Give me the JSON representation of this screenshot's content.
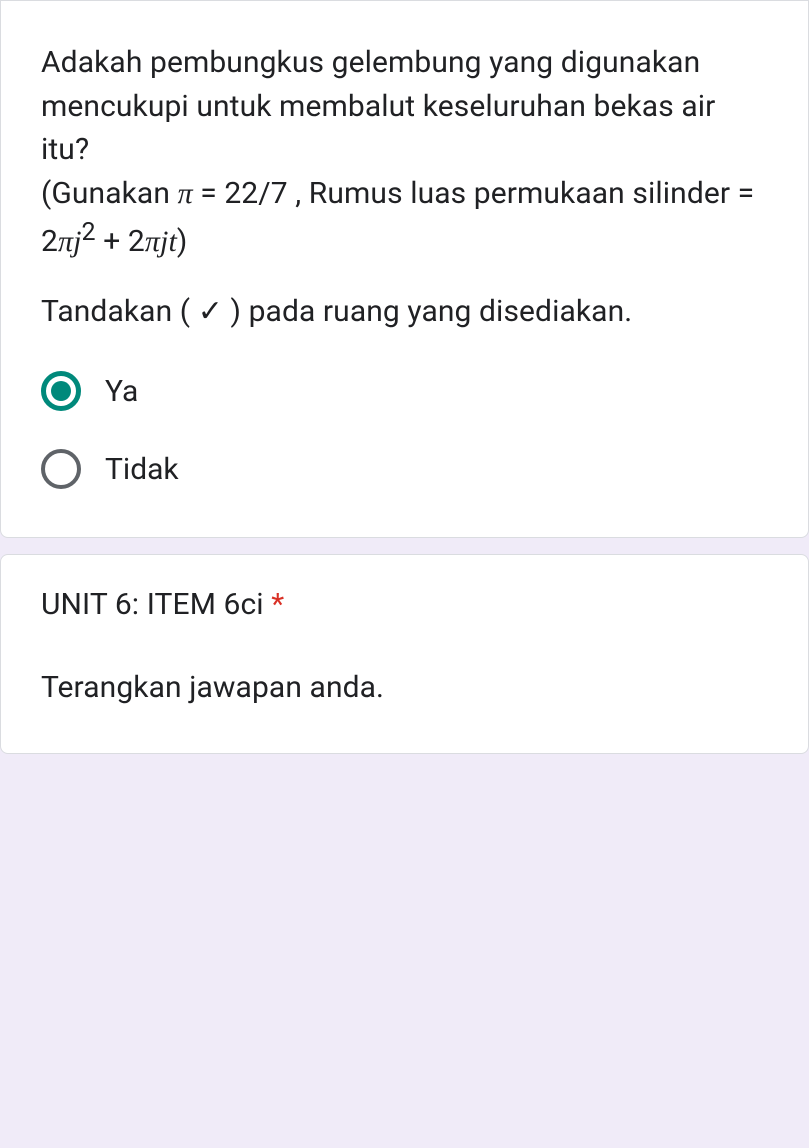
{
  "question1": {
    "line1": "Adakah pembungkus gelembung yang digunakan mencukupi untuk membalut keseluruhan bekas air itu?",
    "pi_prefix": "(Gunakan ",
    "pi_symbol": "π",
    "pi_value": " = 22/7 , Rumus luas permukaan silinder = 2",
    "pi_symbol2": "π",
    "term_j2_j": "j",
    "term_j2_sup": "2",
    "plus": " + 2",
    "pi_symbol3": "π",
    "term_jt": "jt",
    "close_paren": ")",
    "instruction": "Tandakan ( ✓ ) pada ruang yang disediakan.",
    "options": [
      {
        "label": "Ya",
        "selected": true
      },
      {
        "label": "Tidak",
        "selected": false
      }
    ]
  },
  "question2": {
    "title": "UNIT 6: ITEM 6ci ",
    "required": "*",
    "subtext": "Terangkan jawapan anda."
  }
}
